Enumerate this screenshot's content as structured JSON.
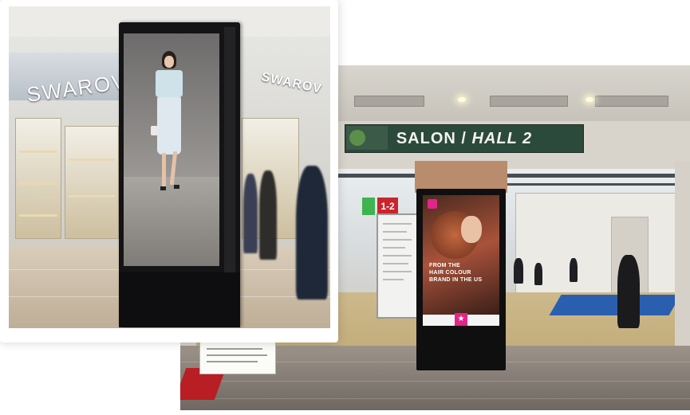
{
  "right_photo": {
    "hall_sign": {
      "prefix": "SALON / ",
      "suffix": "HALL 2"
    },
    "stand_number": "1-2",
    "totem_text": "FROM THE\nHAIR COLOUR\nBRAND IN THE US"
  },
  "left_photo": {
    "store_brand": "SWAROVSKI",
    "store_brand_right": "SWAROV"
  },
  "colors": {
    "sign_green": "#2c4a3b",
    "stand_red": "#c9252d",
    "promo_pink": "#e0268a",
    "carpet_blue": "#2a5fb0"
  }
}
